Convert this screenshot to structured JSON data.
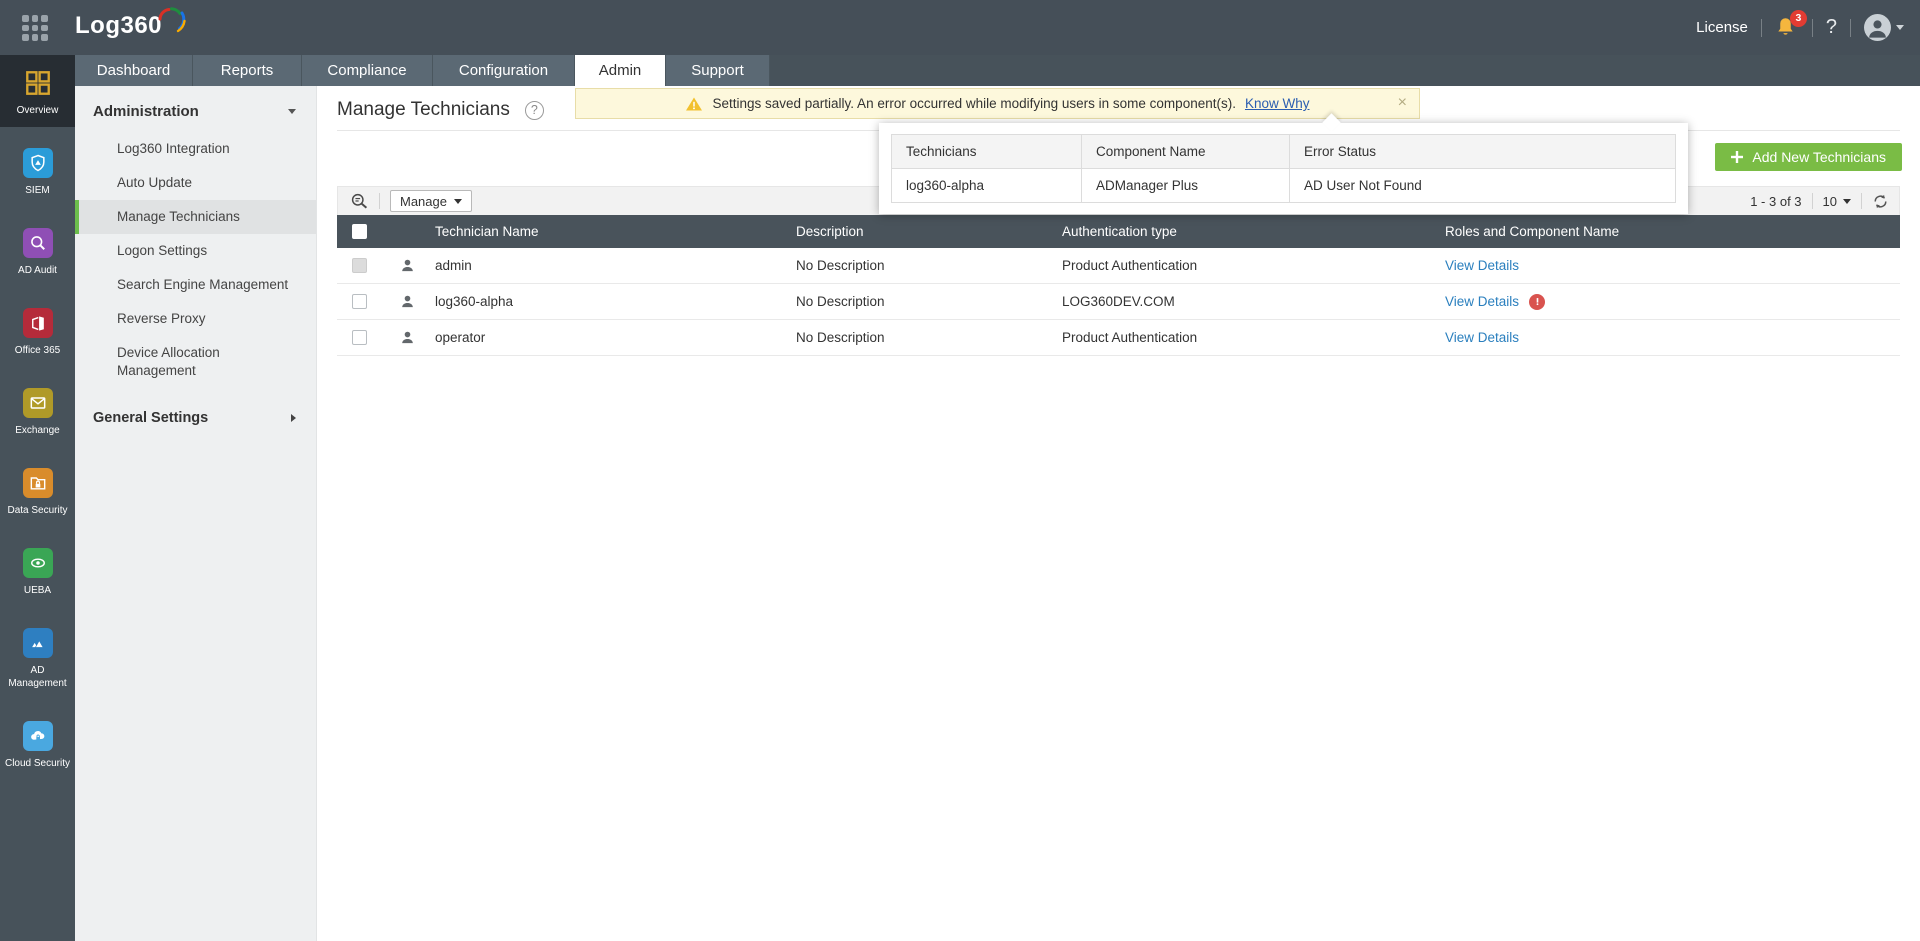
{
  "colors": {
    "topbar_bg": "#454f58",
    "nav_tab_bg": "#5b6974",
    "table_header_bg": "#49535b",
    "accent_green": "#7abc45",
    "selected_item_green": "#6cbe4c",
    "link_blue": "#2a7fbe",
    "warning_banner_bg": "#fdf8dc",
    "error_red": "#d9534f",
    "notification_badge_red": "#e23c33",
    "bell_yellow": "#f5b63e"
  },
  "topbar": {
    "logo": "Log360",
    "license_label": "License",
    "notification_count": "3",
    "help_label": "?"
  },
  "nav": {
    "tabs": [
      {
        "label": "Dashboard",
        "active": false
      },
      {
        "label": "Reports",
        "active": false
      },
      {
        "label": "Compliance",
        "active": false
      },
      {
        "label": "Configuration",
        "active": false
      },
      {
        "label": "Admin",
        "active": true
      },
      {
        "label": "Support",
        "active": false
      }
    ]
  },
  "modules": {
    "items": [
      {
        "label": "Overview",
        "icon": "overview-grid-icon",
        "active": true
      },
      {
        "label": "SIEM",
        "icon": "shield-icon",
        "active": false
      },
      {
        "label": "AD Audit",
        "icon": "audit-search-icon",
        "active": false
      },
      {
        "label": "Office 365",
        "icon": "office365-icon",
        "active": false
      },
      {
        "label": "Exchange",
        "icon": "envelope-icon",
        "active": false
      },
      {
        "label": "Data Security",
        "icon": "folder-lock-icon",
        "active": false
      },
      {
        "label": "UEBA",
        "icon": "eye-icon",
        "active": false
      },
      {
        "label": "AD Management",
        "icon": "ad-triangles-icon",
        "active": false
      },
      {
        "label": "Cloud Security",
        "icon": "cloud-lock-icon",
        "active": false
      }
    ]
  },
  "sidebar": {
    "section_title": "Administration",
    "items": [
      {
        "label": "Log360 Integration",
        "selected": false
      },
      {
        "label": "Auto Update",
        "selected": false
      },
      {
        "label": "Manage Technicians",
        "selected": true
      },
      {
        "label": "Logon Settings",
        "selected": false
      },
      {
        "label": "Search Engine Management",
        "selected": false
      },
      {
        "label": "Reverse Proxy",
        "selected": false
      },
      {
        "label": "Device Allocation Management",
        "selected": false
      }
    ],
    "general_settings_label": "General Settings"
  },
  "page": {
    "title": "Manage Technicians",
    "help_label": "?"
  },
  "banner": {
    "message": "Settings saved partially. An error occurred while modifying users in some component(s).",
    "link_label": "Know Why",
    "close_label": "×"
  },
  "error_popup": {
    "headers": [
      "Technicians",
      "Component Name",
      "Error Status"
    ],
    "rows": [
      {
        "technician": "log360-alpha",
        "component": "ADManager Plus",
        "status": "AD User Not Found"
      }
    ]
  },
  "toolbar": {
    "add_button_label": "Add New Technicians",
    "manage_button_label": "Manage",
    "pagination_range": "1 - 3 of 3",
    "page_size": "10"
  },
  "technicians_table": {
    "headers": [
      "Technician Name",
      "Description",
      "Authentication type",
      "Roles and Component Name"
    ],
    "rows": [
      {
        "name": "admin",
        "description": "No Description",
        "auth_type": "Product Authentication",
        "roles_link": "View Details",
        "has_error": false
      },
      {
        "name": "log360-alpha",
        "description": "No Description",
        "auth_type": "LOG360DEV.COM",
        "roles_link": "View Details",
        "has_error": true
      },
      {
        "name": "operator",
        "description": "No Description",
        "auth_type": "Product Authentication",
        "roles_link": "View Details",
        "has_error": false
      }
    ]
  }
}
